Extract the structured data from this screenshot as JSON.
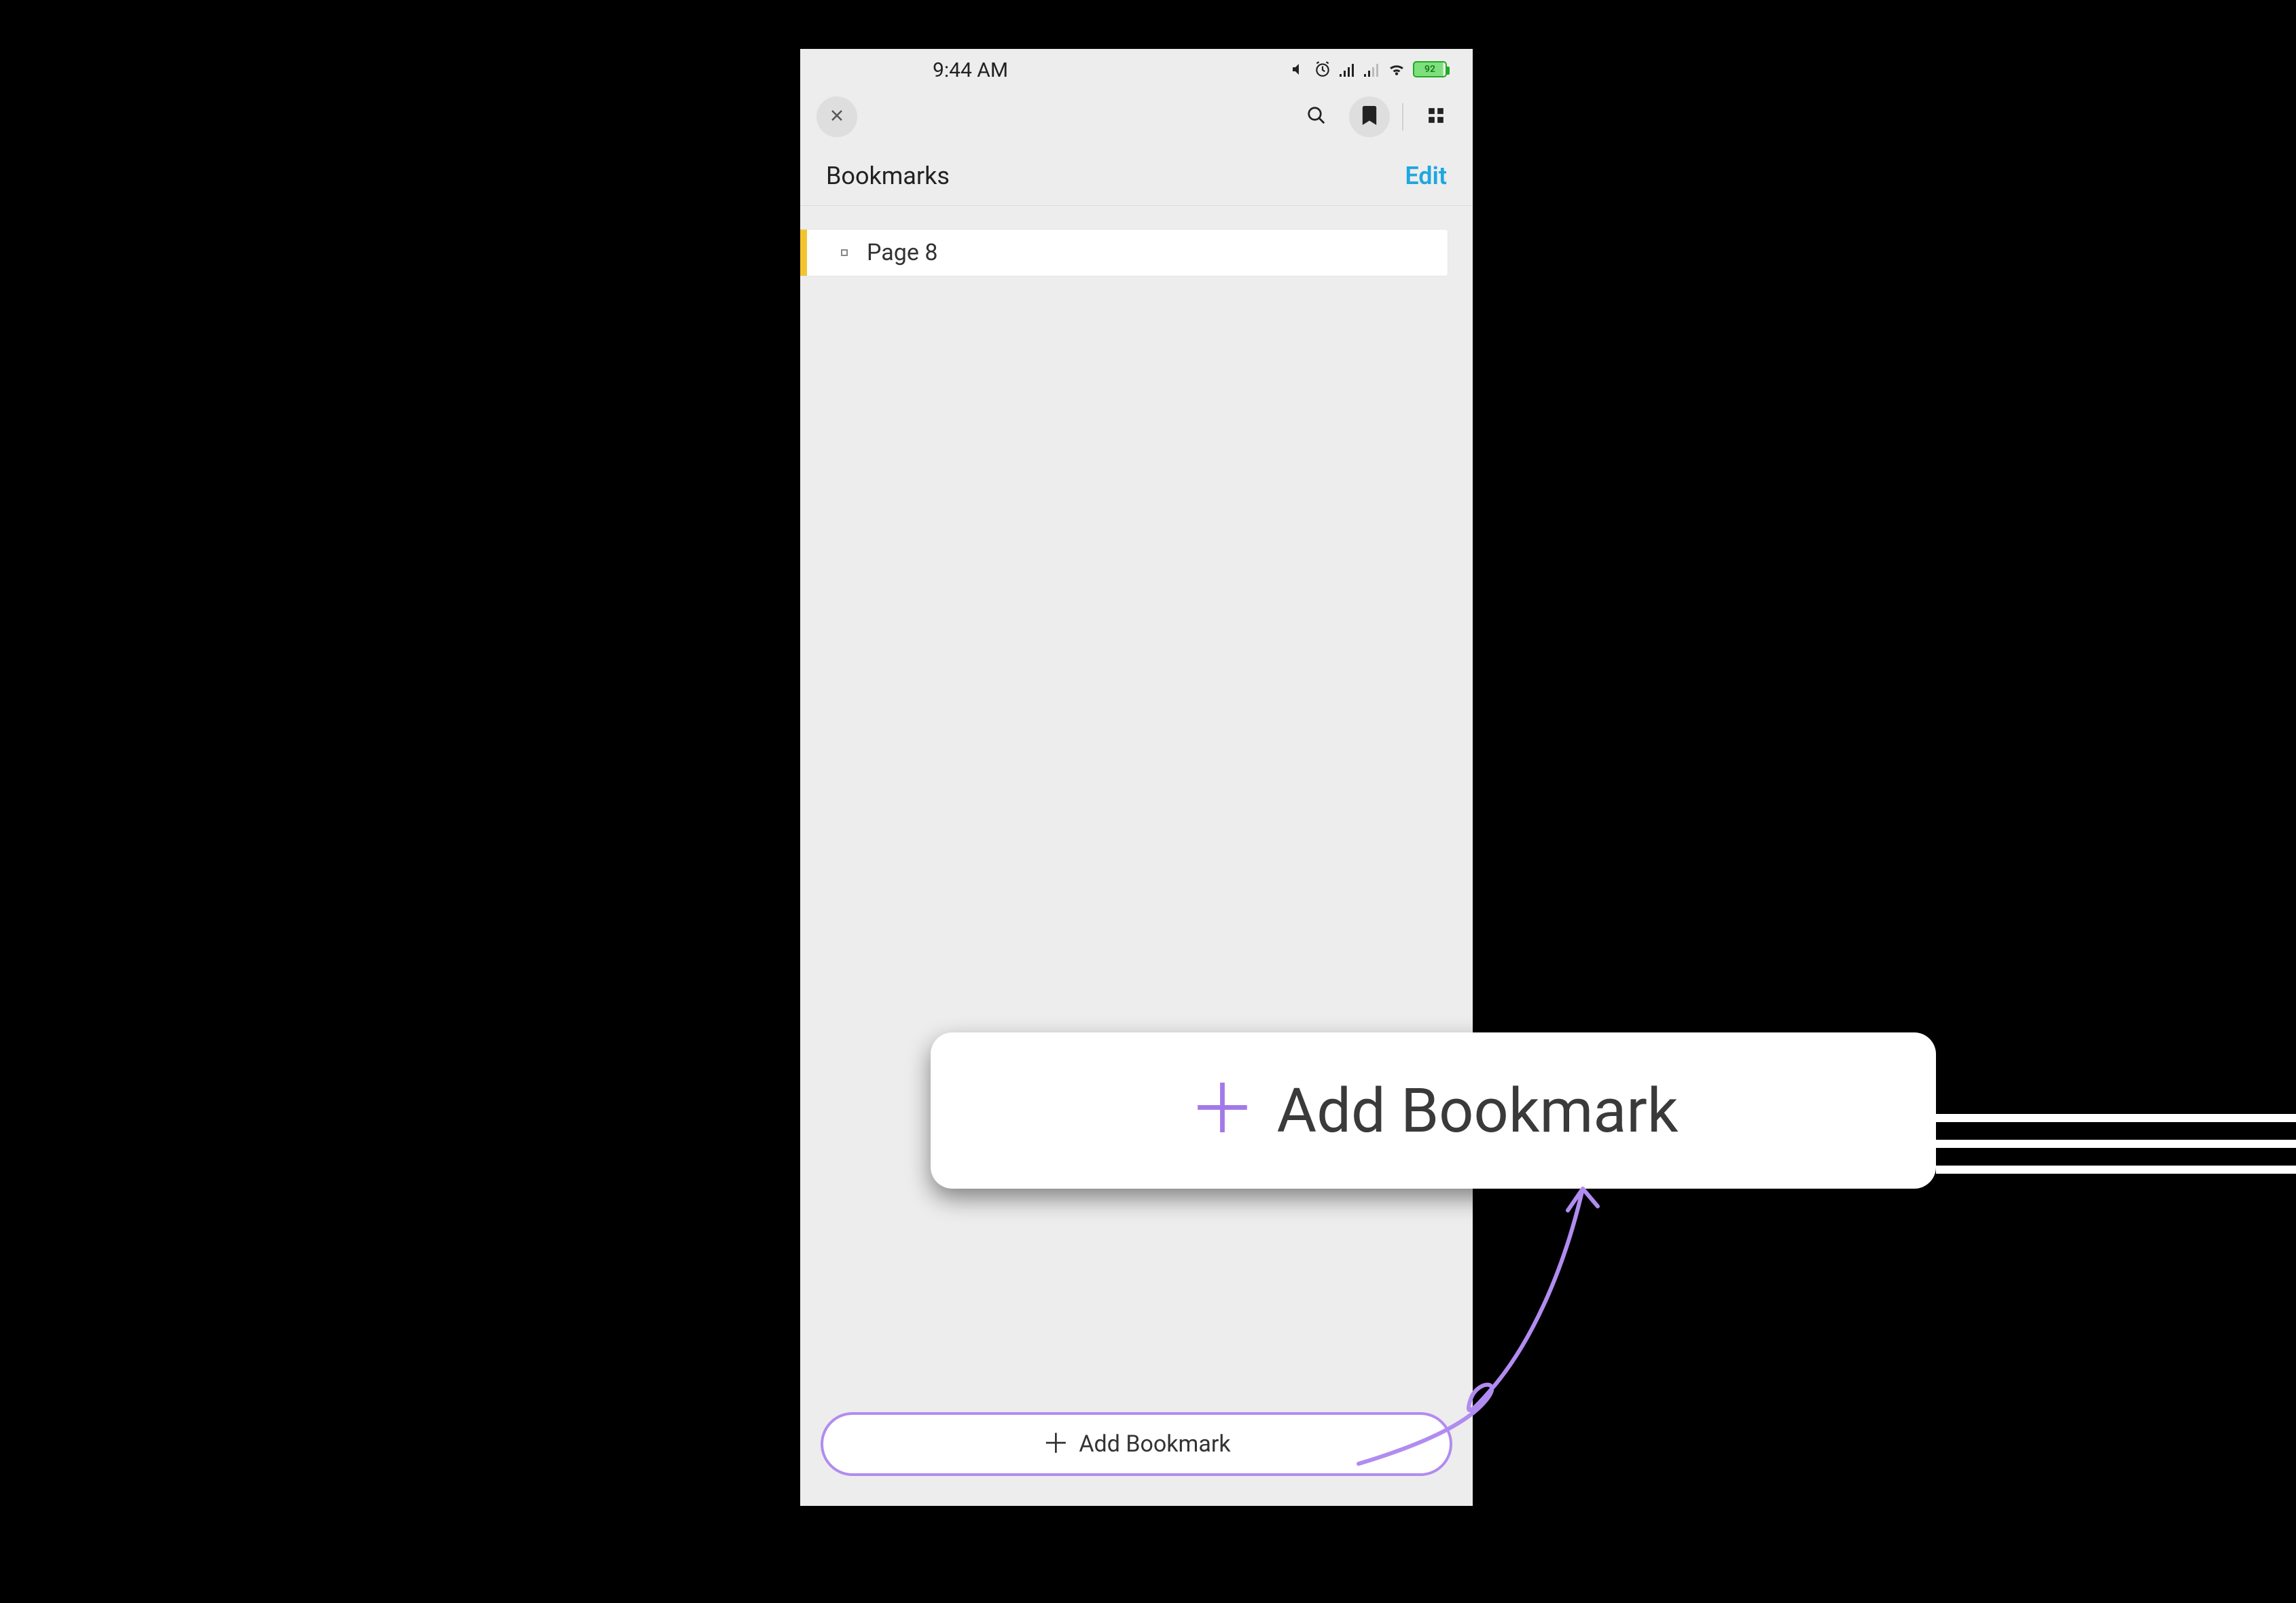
{
  "status": {
    "time": "9:44 AM",
    "battery_pct": "92"
  },
  "header": {
    "title": "Bookmarks",
    "edit_label": "Edit"
  },
  "bookmarks": [
    {
      "label": "Page 8"
    }
  ],
  "actions": {
    "add_label": "Add Bookmark"
  },
  "callout": {
    "label": "Add Bookmark"
  }
}
